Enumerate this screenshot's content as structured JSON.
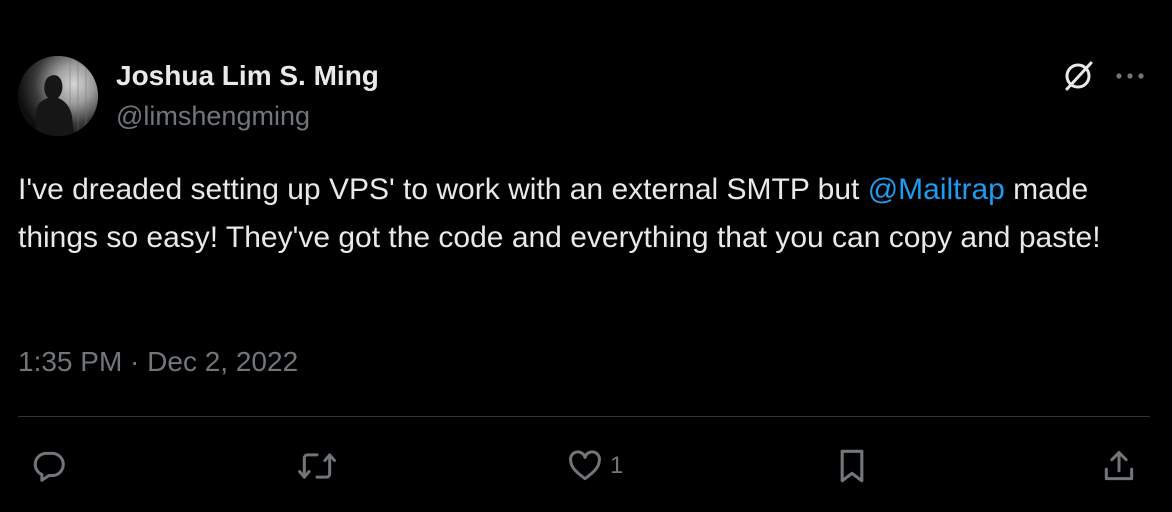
{
  "author": {
    "display_name": "Joshua Lim S. Ming",
    "handle": "@limshengming"
  },
  "tweet": {
    "text_before": "I've dreaded setting up VPS' to work with an external SMTP but ",
    "mention": "@Mailtrap",
    "text_after": " made things so easy! They've got the code and everything that you can copy and paste!",
    "timestamp": "1:35 PM · Dec 2, 2022"
  },
  "actions": {
    "reply_icon": "reply-icon",
    "retweet_icon": "retweet-icon",
    "like_icon": "like-icon",
    "like_count": "1",
    "bookmark_icon": "bookmark-icon",
    "share_icon": "share-icon"
  },
  "header_icons": [
    "grok-icon",
    "more-icon"
  ],
  "colors": {
    "background": "#000000",
    "text": "#e7e9ea",
    "secondary": "#71767b",
    "link": "#1d9bf0",
    "divider": "#2f3336"
  }
}
